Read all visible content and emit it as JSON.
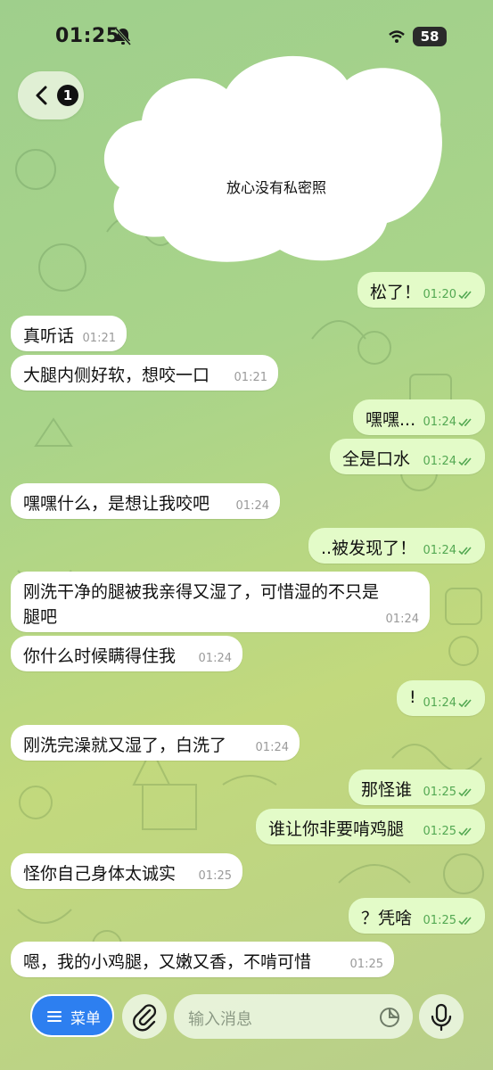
{
  "status_bar": {
    "time": "01:25",
    "battery": "58"
  },
  "header": {
    "back_badge_count": "1"
  },
  "overlay": {
    "text": "放心没有私密照"
  },
  "messages": [
    {
      "dir": "out",
      "text": "松了！",
      "time": "01:20"
    },
    {
      "dir": "in",
      "text": "真听话",
      "time": "01:21"
    },
    {
      "dir": "in",
      "text": "大腿内侧好软，想咬一口",
      "time": "01:21"
    },
    {
      "dir": "out",
      "text": "嘿嘿...",
      "time": "01:24"
    },
    {
      "dir": "out",
      "text": "全是口水",
      "time": "01:24"
    },
    {
      "dir": "in",
      "text": "嘿嘿什么，是想让我咬吧",
      "time": "01:24"
    },
    {
      "dir": "out",
      "text": "..被发现了！",
      "time": "01:24"
    },
    {
      "dir": "in",
      "text_line1": "刚洗干净的腿被我亲得又湿了，可惜湿的不只是",
      "text_line2": "腿吧",
      "time": "01:24"
    },
    {
      "dir": "in",
      "text": "你什么时候瞒得住我",
      "time": "01:24"
    },
    {
      "dir": "out",
      "text": "!",
      "time": "01:24"
    },
    {
      "dir": "in",
      "text": "刚洗完澡就又湿了，白洗了",
      "time": "01:24"
    },
    {
      "dir": "out",
      "text": "那怪谁",
      "time": "01:25"
    },
    {
      "dir": "out",
      "text": "谁让你非要啃鸡腿",
      "time": "01:25"
    },
    {
      "dir": "in",
      "text": "怪你自己身体太诚实",
      "time": "01:25"
    },
    {
      "dir": "out",
      "text": "？凭啥",
      "time": "01:25"
    },
    {
      "dir": "in",
      "text": "嗯，我的小鸡腿，又嫩又香，不啃可惜",
      "time": "01:25"
    }
  ],
  "composer": {
    "menu_label": "菜单",
    "input_placeholder": "输入消息"
  },
  "colors": {
    "incoming_bubble": "#ffffff",
    "outgoing_bubble": "#e3fbc8",
    "check_color": "#53a852",
    "menu_blue": "#2d7ff0"
  }
}
